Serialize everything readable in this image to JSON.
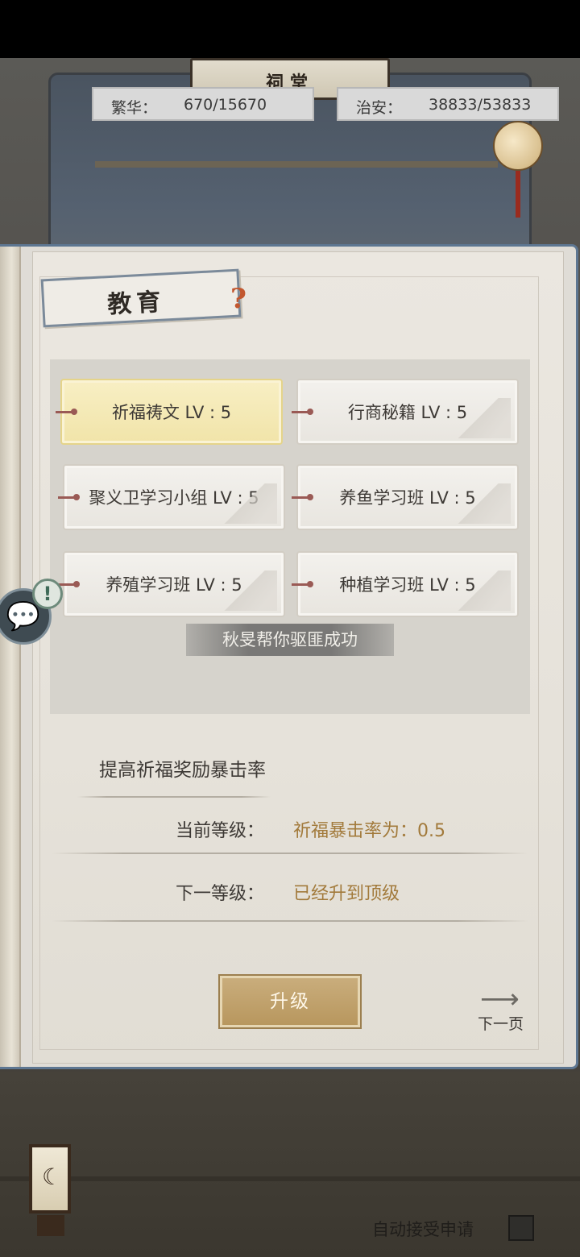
{
  "header": {
    "building_sign": "祠堂",
    "prosperity": {
      "label": "繁华：",
      "value": "670/15670"
    },
    "security": {
      "label": "治安：",
      "value": "38833/53833"
    }
  },
  "panel": {
    "title": "教育",
    "help_icon": "question-mark-icon"
  },
  "skills": [
    {
      "label": "祈福祷文 LV : 5",
      "selected": true
    },
    {
      "label": "行商秘籍 LV : 5",
      "selected": false
    },
    {
      "label": "聚义卫学习小组 LV : 5",
      "selected": false
    },
    {
      "label": "养鱼学习班 LV : 5",
      "selected": false
    },
    {
      "label": "养殖学习班 LV : 5",
      "selected": false
    },
    {
      "label": "种植学习班 LV : 5",
      "selected": false
    }
  ],
  "toast": "秋旻帮你驱匪成功",
  "detail": {
    "description": "提高祈福奖励暴击率",
    "current_label": "当前等级：",
    "current_value": "祈福暴击率为：0.5",
    "next_label": "下一等级：",
    "next_value": "已经升到顶级"
  },
  "actions": {
    "upgrade": "升级",
    "next_page": "下一页"
  },
  "footer": {
    "auto_accept": "自动接受申请",
    "auto_accept_checked": false
  },
  "colors": {
    "accent_gold": "#a27a3b",
    "selected_skill_bg": "#f1e4a9",
    "panel_border": "#5d7691",
    "help_icon": "#c2572f"
  }
}
